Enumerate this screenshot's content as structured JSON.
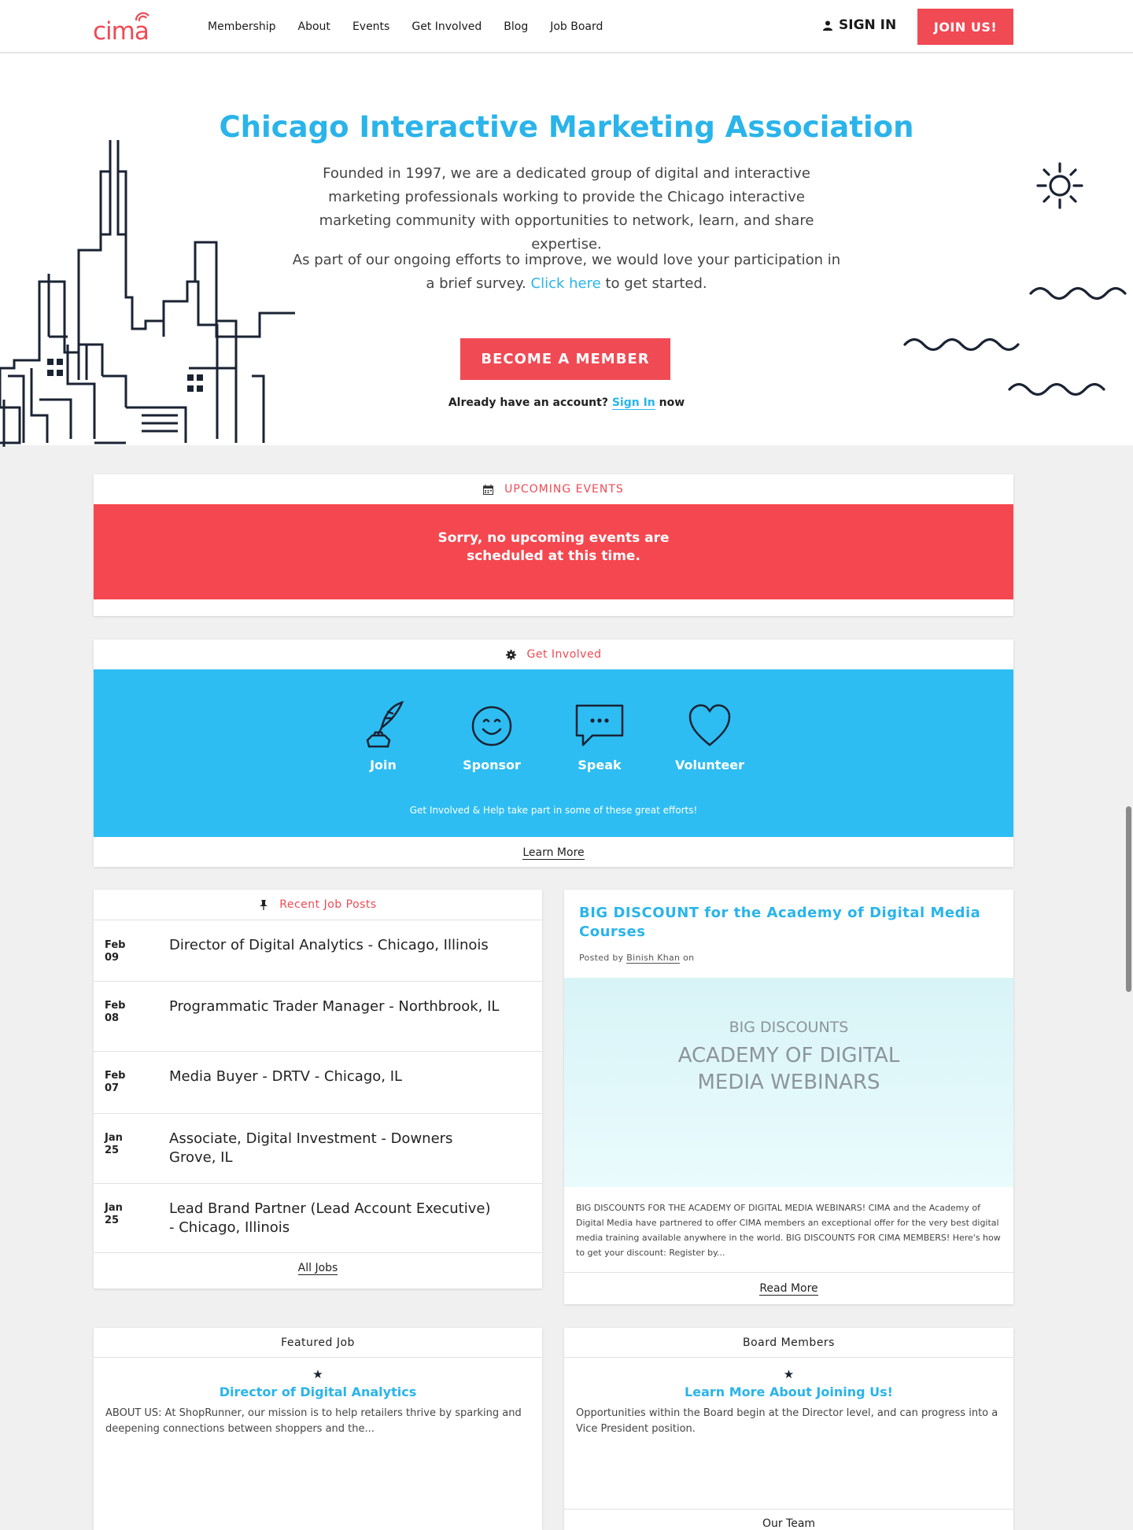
{
  "nav": {
    "logo": "cima",
    "links": [
      "Membership",
      "About",
      "Events",
      "Get Involved",
      "Blog",
      "Job Board"
    ],
    "sign_in": "SIGN IN",
    "join": "JOIN US!"
  },
  "hero": {
    "title": "Chicago Interactive Marketing Association",
    "paragraph1": "Founded in 1997, we are a dedicated group of digital and interactive marketing professionals working to provide the Chicago interactive marketing community with opportunities to network, learn, and share expertise.",
    "paragraph2_before": "As part of our ongoing efforts to improve, we would love your participation in a brief survey.",
    "paragraph2_link": "Click here",
    "paragraph2_after": "to get started.",
    "cta": "BECOME A MEMBER",
    "already_before": "Already have an account?",
    "already_link": "Sign In",
    "already_after": "now"
  },
  "events": {
    "header": "UPCOMING EVENTS",
    "message_line1": "Sorry, no upcoming events are",
    "message_line2": "scheduled at this time."
  },
  "involved": {
    "header": "Get Involved",
    "items": [
      "Join",
      "Sponsor",
      "Speak",
      "Volunteer"
    ],
    "caption": "Get Involved & Help take part in some of these great efforts!",
    "learn_more": "Learn More"
  },
  "jobs": {
    "header": "Recent Job Posts",
    "items": [
      {
        "month": "Feb",
        "day": "09",
        "title": "Director of Digital Analytics - Chicago, Illinois"
      },
      {
        "month": "Feb",
        "day": "08",
        "title": "Programmatic Trader Manager - Northbrook, IL"
      },
      {
        "month": "Feb",
        "day": "07",
        "title": "Media Buyer - DRTV - Chicago, IL"
      },
      {
        "month": "Jan",
        "day": "25",
        "title": "Associate, Digital Investment - Downers Grove, IL"
      },
      {
        "month": "Jan",
        "day": "25",
        "title": "Lead Brand Partner (Lead Account Executive) - Chicago, Illinois"
      }
    ],
    "all_jobs": "All Jobs"
  },
  "blog": {
    "title": "BIG DISCOUNT for the Academy of Digital Media Courses",
    "posted_by": "Posted by",
    "author": "Binish Khan",
    "posted_on": "on",
    "image_line1": "BIG DISCOUNTS",
    "image_line2": "ACADEMY OF DIGITAL",
    "image_line3": "MEDIA WEBINARS",
    "excerpt": "BIG DISCOUNTS FOR THE ACADEMY OF DIGITAL MEDIA WEBINARS! CIMA and the Academy of Digital Media have partnered to offer CIMA members an exceptional offer for the very best digital media training available anywhere in the world. BIG DISCOUNTS FOR CIMA MEMBERS! Here's how to get your discount: Register by...",
    "read_more": "Read More"
  },
  "featured": {
    "header": "Featured Job",
    "title": "Director of Digital Analytics",
    "body": "ABOUT US: At ShopRunner, our mission is to help retailers thrive by sparking and deepening connections between shoppers and the..."
  },
  "board": {
    "header": "Board Members",
    "title": "Learn More About Joining Us!",
    "body": "Opportunities within the Board begin at the Director level, and can progress into a Vice President position.",
    "our_team": "Our Team"
  },
  "colors": {
    "brand_red": "#f04a55",
    "brand_blue": "#2ab4ea",
    "band_blue": "#2dbdf2",
    "navy": "#1a2333"
  }
}
